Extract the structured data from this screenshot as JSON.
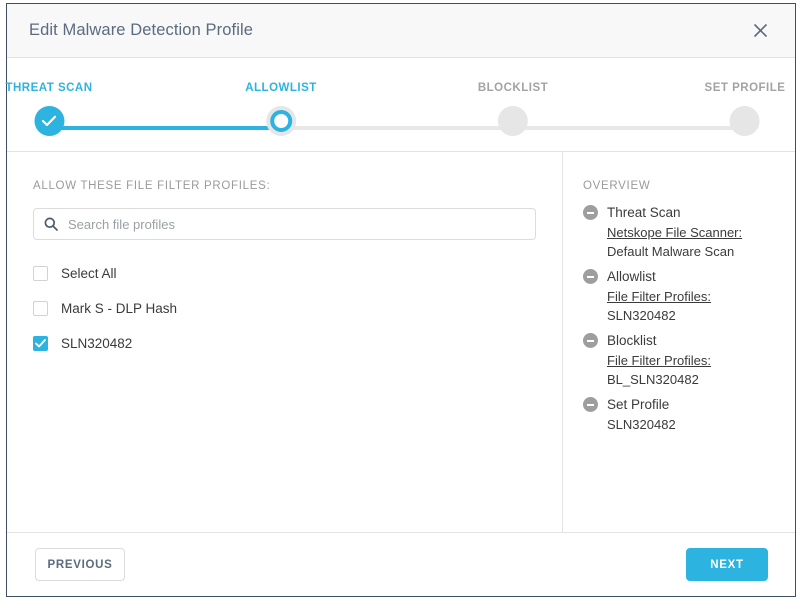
{
  "header": {
    "title": "Edit Malware Detection Profile",
    "close_icon": "close-icon"
  },
  "stepper": {
    "steps": [
      {
        "label": "THREAT SCAN",
        "state": "done"
      },
      {
        "label": "ALLOWLIST",
        "state": "active"
      },
      {
        "label": "BLOCKLIST",
        "state": "todo"
      },
      {
        "label": "SET PROFILE",
        "state": "todo"
      }
    ],
    "accent_color": "#2cb3e0",
    "inactive_color": "#e6e6e6"
  },
  "left_pane": {
    "section_label": "ALLOW THESE FILE FILTER PROFILES:",
    "search": {
      "placeholder": "Search file profiles",
      "value": "",
      "icon": "search-icon"
    },
    "checkboxes": [
      {
        "label": "Select All",
        "checked": false
      },
      {
        "label": "Mark S - DLP Hash",
        "checked": false
      },
      {
        "label": "SLN320482",
        "checked": true
      }
    ]
  },
  "overview": {
    "title": "OVERVIEW",
    "groups": [
      {
        "name": "Threat Scan",
        "key": "Netskope File Scanner:",
        "value": "Default Malware Scan"
      },
      {
        "name": "Allowlist",
        "key": "File Filter Profiles:",
        "value": "SLN320482"
      },
      {
        "name": "Blocklist",
        "key": "File Filter Profiles:",
        "value": "BL_SLN320482"
      },
      {
        "name": "Set Profile",
        "key": "",
        "value": "SLN320482"
      }
    ]
  },
  "footer": {
    "previous_label": "PREVIOUS",
    "next_label": "NEXT"
  }
}
